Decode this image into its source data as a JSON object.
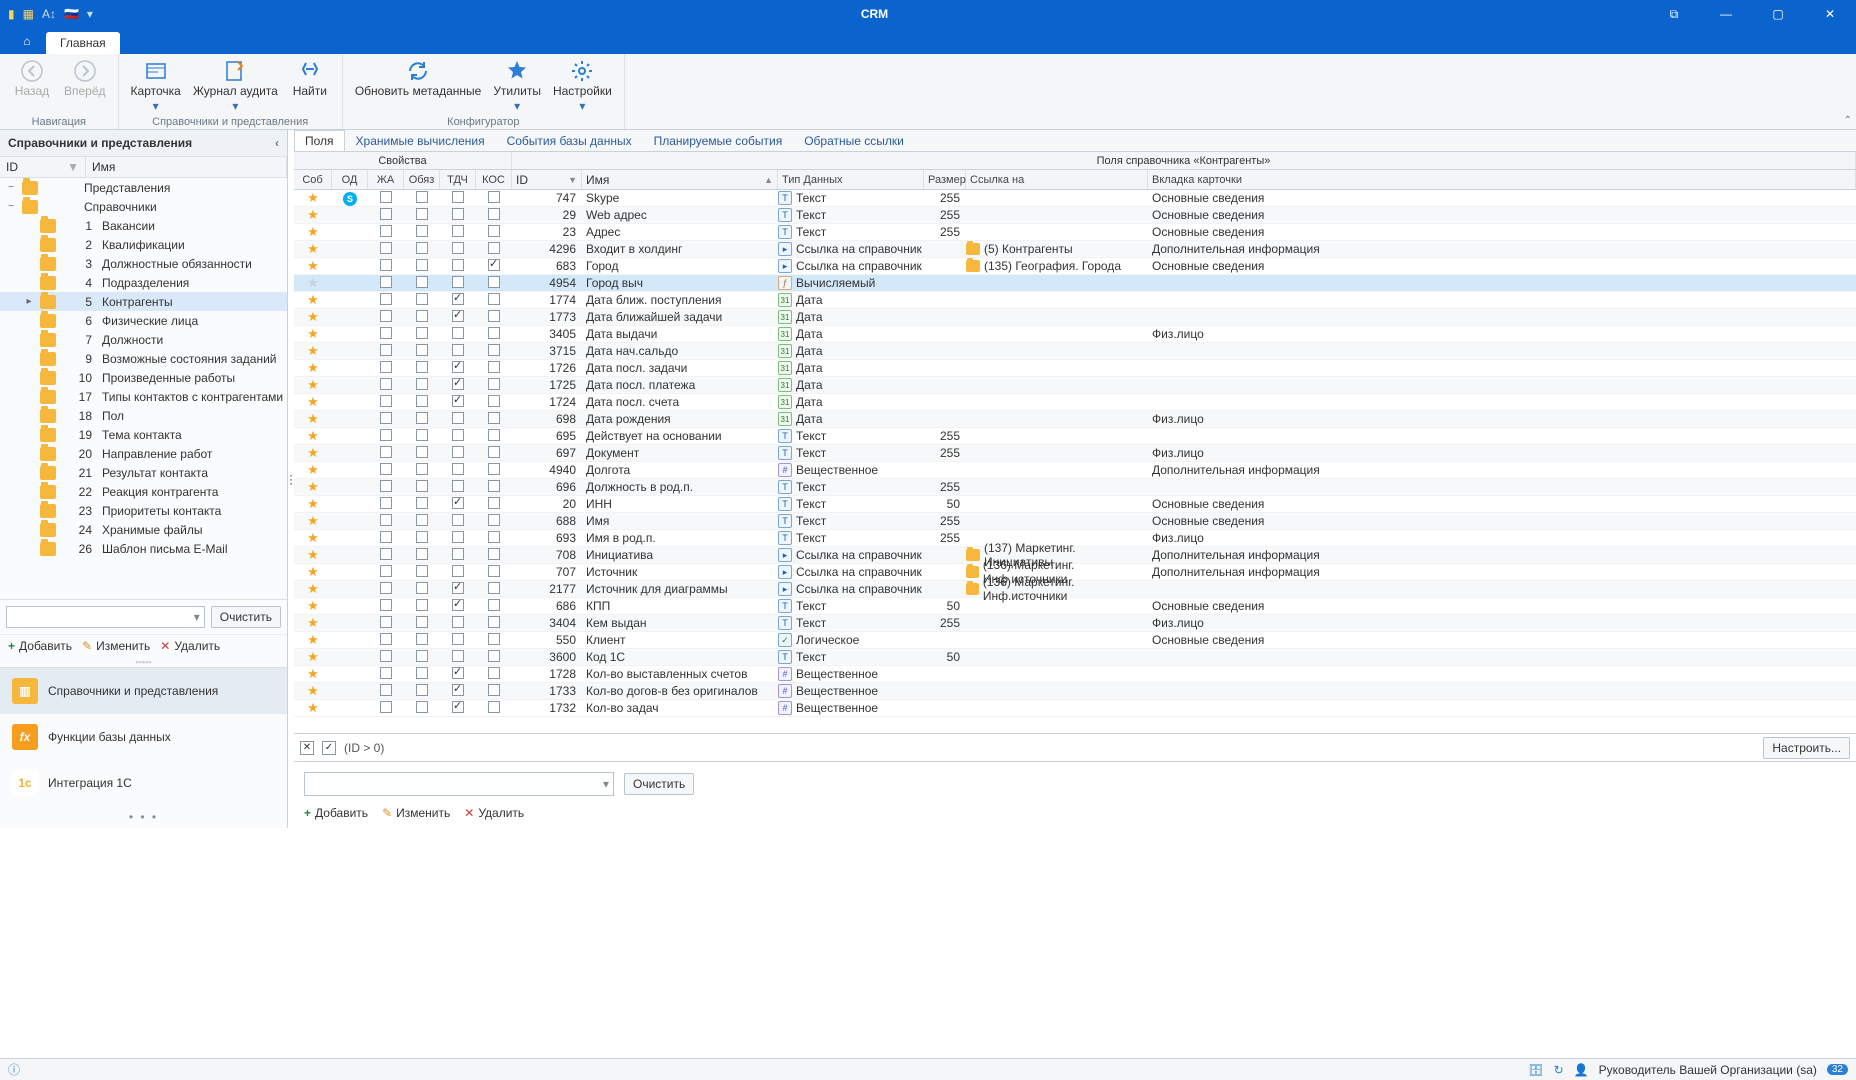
{
  "title": "CRM",
  "mainTab": "Главная",
  "ribbon": {
    "groups": [
      {
        "label": "Навигация",
        "buttons": [
          {
            "id": "back",
            "label": "Назад"
          },
          {
            "id": "fwd",
            "label": "Вперёд"
          }
        ]
      },
      {
        "label": "Справочники и представления",
        "buttons": [
          {
            "id": "card",
            "label": "Карточка",
            "drop": true
          },
          {
            "id": "audit",
            "label": "Журнал аудита",
            "drop": true
          },
          {
            "id": "find",
            "label": "Найти"
          }
        ]
      },
      {
        "label": "Конфигуратор",
        "buttons": [
          {
            "id": "refresh",
            "label": "Обновить метаданные"
          },
          {
            "id": "util",
            "label": "Утилиты",
            "drop": true
          },
          {
            "id": "settings",
            "label": "Настройки",
            "drop": true
          }
        ]
      }
    ]
  },
  "side": {
    "title": "Справочники и представления",
    "cols": {
      "id": "ID",
      "name": "Имя"
    },
    "tree": [
      {
        "ex": "−",
        "num": "",
        "label": "Представления",
        "lvl": 0
      },
      {
        "ex": "−",
        "num": "",
        "label": "Справочники",
        "lvl": 0
      },
      {
        "ex": "",
        "num": "1",
        "label": "Вакансии",
        "lvl": 1
      },
      {
        "ex": "",
        "num": "2",
        "label": "Квалификации",
        "lvl": 1
      },
      {
        "ex": "",
        "num": "3",
        "label": "Должностные обязанности",
        "lvl": 1
      },
      {
        "ex": "",
        "num": "4",
        "label": "Подразделения",
        "lvl": 1
      },
      {
        "ex": "▸",
        "num": "5",
        "label": "Контрагенты",
        "lvl": 1,
        "sel": true
      },
      {
        "ex": "",
        "num": "6",
        "label": "Физические лица",
        "lvl": 1
      },
      {
        "ex": "",
        "num": "7",
        "label": "Должности",
        "lvl": 1
      },
      {
        "ex": "",
        "num": "9",
        "label": "Возможные состояния заданий",
        "lvl": 1
      },
      {
        "ex": "",
        "num": "10",
        "label": "Произведенные работы",
        "lvl": 1
      },
      {
        "ex": "",
        "num": "17",
        "label": "Типы контактов с контрагентами",
        "lvl": 1
      },
      {
        "ex": "",
        "num": "18",
        "label": "Пол",
        "lvl": 1
      },
      {
        "ex": "",
        "num": "19",
        "label": "Тема контакта",
        "lvl": 1
      },
      {
        "ex": "",
        "num": "20",
        "label": "Направление работ",
        "lvl": 1
      },
      {
        "ex": "",
        "num": "21",
        "label": "Результат контакта",
        "lvl": 1
      },
      {
        "ex": "",
        "num": "22",
        "label": "Реакция контрагента",
        "lvl": 1
      },
      {
        "ex": "",
        "num": "23",
        "label": "Приоритеты контакта",
        "lvl": 1
      },
      {
        "ex": "",
        "num": "24",
        "label": "Хранимые файлы",
        "lvl": 1
      },
      {
        "ex": "",
        "num": "26",
        "label": "Шаблон письма E-Mail",
        "lvl": 1
      }
    ],
    "clear": "Очистить",
    "actions": {
      "add": "Добавить",
      "edit": "Изменить",
      "del": "Удалить"
    },
    "panes": [
      {
        "id": "sp",
        "label": "Справочники и представления",
        "active": true
      },
      {
        "id": "fx",
        "label": "Функции базы данных"
      },
      {
        "id": "ic",
        "label": "Интеграция 1С"
      }
    ]
  },
  "content": {
    "tabs": [
      "Поля",
      "Хранимые вычисления",
      "События базы данных",
      "Планируемые события",
      "Обратные ссылки"
    ],
    "activeTab": 0,
    "groupTitles": {
      "props": "Свойства",
      "fields": "Поля справочника «Контрагенты»"
    },
    "headers": {
      "sob": "Соб",
      "od": "ОД",
      "ja": "ЖА",
      "req": "Обяз",
      "tdc": "ТДЧ",
      "kos": "КОС",
      "id": "ID",
      "name": "Имя",
      "type": "Тип Данных",
      "size": "Размер",
      "link": "Ссылка на",
      "tab": "Вкладка карточки"
    },
    "rows": [
      {
        "star": 1,
        "od": "skype",
        "id": 747,
        "name": "Skype",
        "ty": "T",
        "type": "Текст",
        "sz": 255,
        "tab": "Основные сведения"
      },
      {
        "star": 1,
        "id": 29,
        "name": "Web адрес",
        "ty": "T",
        "type": "Текст",
        "sz": 255,
        "tab": "Основные сведения"
      },
      {
        "star": 1,
        "id": 23,
        "name": "Адрес",
        "ty": "T",
        "type": "Текст",
        "sz": 255,
        "tab": "Основные сведения"
      },
      {
        "star": 1,
        "id": 4296,
        "name": "Входит в холдинг",
        "ty": "L",
        "type": "Ссылка на справочник",
        "link": "(5) Контрагенты",
        "tab": "Дополнительная информация"
      },
      {
        "star": 1,
        "kos": true,
        "id": 683,
        "name": "Город",
        "ty": "L",
        "type": "Ссылка на справочник",
        "link": "(135) География. Города",
        "tab": "Основные сведения"
      },
      {
        "star": 0,
        "hl": true,
        "id": 4954,
        "name": "Город выч",
        "ty": "F",
        "type": "Вычисляемый"
      },
      {
        "star": 1,
        "req": true,
        "id": 1774,
        "name": "Дата ближ. поступления",
        "ty": "D",
        "type": "Дата"
      },
      {
        "star": 1,
        "req": true,
        "id": 1773,
        "name": "Дата ближайшей задачи",
        "ty": "D",
        "type": "Дата"
      },
      {
        "star": 1,
        "id": 3405,
        "name": "Дата выдачи",
        "ty": "D",
        "type": "Дата",
        "tab": "Физ.лицо"
      },
      {
        "star": 1,
        "id": 3715,
        "name": "Дата нач.сальдо",
        "ty": "D",
        "type": "Дата"
      },
      {
        "star": 1,
        "req": true,
        "id": 1726,
        "name": "Дата посл. задачи",
        "ty": "D",
        "type": "Дата"
      },
      {
        "star": 1,
        "req": true,
        "id": 1725,
        "name": "Дата посл. платежа",
        "ty": "D",
        "type": "Дата"
      },
      {
        "star": 1,
        "req": true,
        "id": 1724,
        "name": "Дата посл. счета",
        "ty": "D",
        "type": "Дата"
      },
      {
        "star": 1,
        "id": 698,
        "name": "Дата рождения",
        "ty": "D",
        "type": "Дата",
        "tab": "Физ.лицо"
      },
      {
        "star": 1,
        "id": 695,
        "name": "Действует на основании",
        "ty": "T",
        "type": "Текст",
        "sz": 255
      },
      {
        "star": 1,
        "id": 697,
        "name": "Документ",
        "ty": "T",
        "type": "Текст",
        "sz": 255,
        "tab": "Физ.лицо"
      },
      {
        "star": 1,
        "id": 4940,
        "name": "Долгота",
        "ty": "N",
        "type": "Вещественное",
        "tab": "Дополнительная информация"
      },
      {
        "star": 1,
        "id": 696,
        "name": "Должность в род.п.",
        "ty": "T",
        "type": "Текст",
        "sz": 255
      },
      {
        "star": 1,
        "req": true,
        "id": 20,
        "name": "ИНН",
        "ty": "T",
        "type": "Текст",
        "sz": 50,
        "tab": "Основные сведения"
      },
      {
        "star": 1,
        "id": 688,
        "name": "Имя",
        "ty": "T",
        "type": "Текст",
        "sz": 255,
        "tab": "Основные сведения"
      },
      {
        "star": 1,
        "id": 693,
        "name": "Имя в род.п.",
        "ty": "T",
        "type": "Текст",
        "sz": 255,
        "tab": "Физ.лицо"
      },
      {
        "star": 1,
        "id": 708,
        "name": "Инициатива",
        "ty": "L",
        "type": "Ссылка на справочник",
        "link": "(137) Маркетинг. Инициативы",
        "tab": "Дополнительная информация"
      },
      {
        "star": 1,
        "id": 707,
        "name": "Источник",
        "ty": "L",
        "type": "Ссылка на справочник",
        "link": "(136) Маркетинг. Инф.источники",
        "tab": "Дополнительная информация"
      },
      {
        "star": 1,
        "req": true,
        "id": 2177,
        "name": "Источник для диаграммы",
        "ty": "L",
        "type": "Ссылка на справочник",
        "link": "(136) Маркетинг. Инф.источники"
      },
      {
        "star": 1,
        "req": true,
        "id": 686,
        "name": "КПП",
        "ty": "T",
        "type": "Текст",
        "sz": 50,
        "tab": "Основные сведения"
      },
      {
        "star": 1,
        "id": 3404,
        "name": "Кем выдан",
        "ty": "T",
        "type": "Текст",
        "sz": 255,
        "tab": "Физ.лицо"
      },
      {
        "star": 1,
        "id": 550,
        "name": "Клиент",
        "ty": "B",
        "type": "Логическое",
        "tab": "Основные сведения"
      },
      {
        "star": 1,
        "id": 3600,
        "name": "Код 1С",
        "ty": "T",
        "type": "Текст",
        "sz": 50
      },
      {
        "star": 1,
        "req": true,
        "id": 1728,
        "name": "Кол-во выставленных счетов",
        "ty": "N",
        "type": "Вещественное"
      },
      {
        "star": 1,
        "req": true,
        "id": 1733,
        "name": "Кол-во догов-в без оригиналов",
        "ty": "N",
        "type": "Вещественное"
      },
      {
        "star": 1,
        "req": true,
        "id": 1732,
        "name": "Кол-во задач",
        "ty": "N",
        "type": "Вещественное"
      }
    ],
    "filter": {
      "expr": "(ID > 0)",
      "btn": "Настроить..."
    },
    "bottom": {
      "clear": "Очистить",
      "add": "Добавить",
      "edit": "Изменить",
      "del": "Удалить"
    }
  },
  "status": {
    "user": "Руководитель Вашей Организации (sa)",
    "count": "32"
  }
}
